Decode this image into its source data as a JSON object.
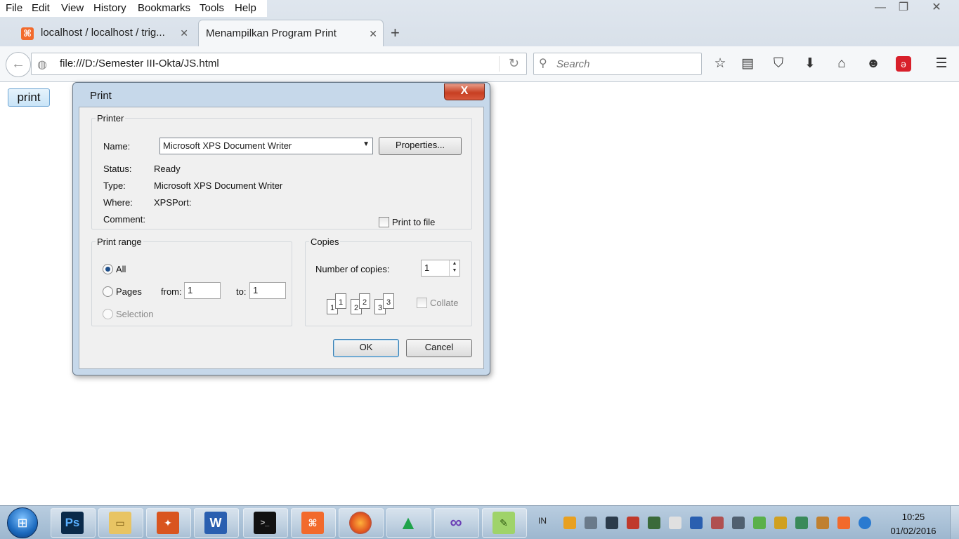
{
  "menubar": {
    "items": [
      "File",
      "Edit",
      "View",
      "History",
      "Bookmarks",
      "Tools",
      "Help"
    ]
  },
  "window_controls": {
    "minimize": "—",
    "restore": "❐",
    "close": "✕"
  },
  "tabs": [
    {
      "title": "localhost / localhost / trig...",
      "close": "✕"
    },
    {
      "title": "Menampilkan Program Print",
      "close": "✕"
    }
  ],
  "new_tab": "+",
  "navbar": {
    "url": "file:///D:/Semester III-Okta/JS.html",
    "search_placeholder": "Search"
  },
  "toolbar_icons": [
    "star-icon",
    "reading-list-icon",
    "pocket-icon",
    "download-icon",
    "home-icon",
    "hello-icon",
    "avira-icon",
    "hamburger-menu-icon"
  ],
  "page": {
    "print_button_label": "print"
  },
  "dialog": {
    "title": "Print",
    "close_label": "X",
    "printer": {
      "legend": "Printer",
      "name_label": "Name:",
      "name_value": "Microsoft XPS Document Writer",
      "properties_label": "Properties...",
      "status_label": "Status:",
      "status_value": "Ready",
      "type_label": "Type:",
      "type_value": "Microsoft XPS Document Writer",
      "where_label": "Where:",
      "where_value": "XPSPort:",
      "comment_label": "Comment:",
      "print_to_file_label": "Print to file"
    },
    "print_range": {
      "legend": "Print range",
      "all_label": "All",
      "pages_label": "Pages",
      "from_label": "from:",
      "from_value": "1",
      "to_label": "to:",
      "to_value": "1",
      "selection_label": "Selection"
    },
    "copies": {
      "legend": "Copies",
      "number_label": "Number of copies:",
      "number_value": "1",
      "collate_label": "Collate",
      "collate_pages": [
        "1",
        "1",
        "2",
        "2",
        "3",
        "3"
      ]
    },
    "ok_label": "OK",
    "cancel_label": "Cancel"
  },
  "taskbar": {
    "apps": [
      "windows-start-icon",
      "photoshop-icon",
      "file-explorer-icon",
      "game-icon",
      "word-icon",
      "command-prompt-icon",
      "xampp-icon",
      "firefox-icon",
      "android-studio-icon",
      "visual-studio-icon",
      "notepad-plus-plus-icon"
    ],
    "photoshop_text": "Ps",
    "word_text": "W",
    "tray_lang": "IN",
    "clock_time": "10:25",
    "clock_date": "01/02/2016"
  },
  "colors": {
    "dialog_close": "#c73f22",
    "print_button": "#c9e4f7",
    "taskbar": "#9db7cf"
  }
}
